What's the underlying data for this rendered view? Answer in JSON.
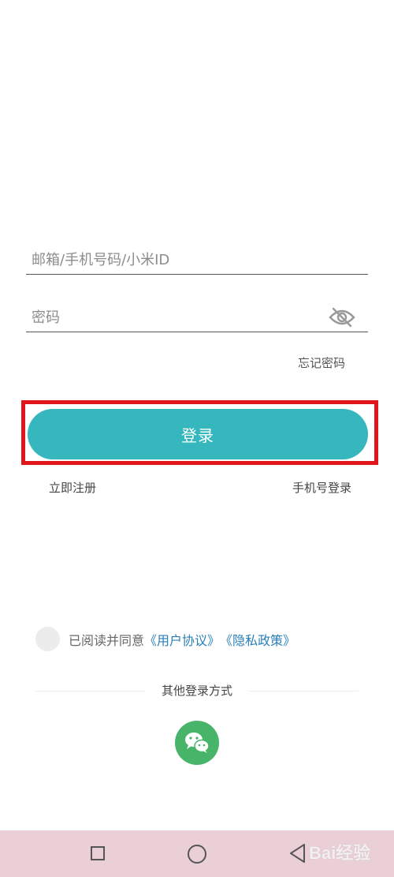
{
  "form": {
    "account_placeholder": "邮箱/手机号码/小米ID",
    "password_placeholder": "密码",
    "forgot_password": "忘记密码",
    "login_button": "登录",
    "register_link": "立即注册",
    "phone_login_link": "手机号登录"
  },
  "agreement": {
    "text": "已阅读并同意",
    "user_agreement": "《用户协议》",
    "privacy_policy": "《隐私政策》",
    "checked": false
  },
  "other_login": {
    "label": "其他登录方式",
    "methods": [
      "wechat-icon"
    ]
  },
  "nav": {
    "icons": [
      "recent-apps-icon",
      "home-icon",
      "back-icon"
    ]
  },
  "watermark": {
    "text": "Bai经验"
  },
  "colors": {
    "accent": "#36b7bd",
    "highlight": "#e0161d",
    "link": "#2a7fb8",
    "wechat": "#48b46a",
    "navbar": "#ebcfd7"
  },
  "icons": {
    "password_toggle": "eye-slash-icon"
  }
}
